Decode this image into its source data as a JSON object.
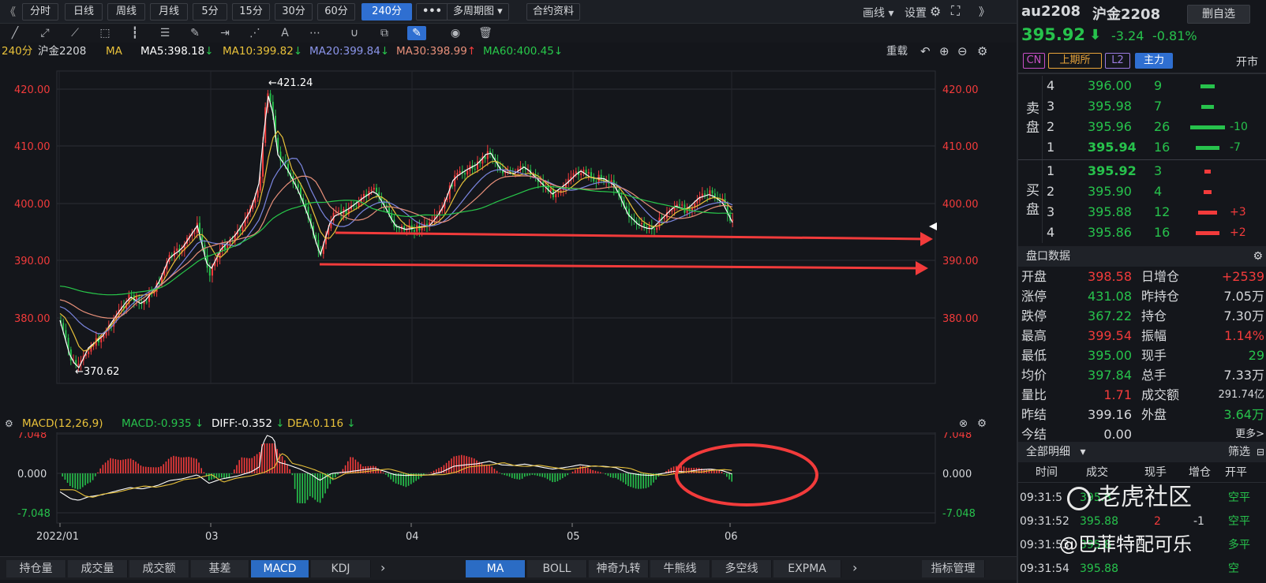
{
  "toolbar": {
    "periods": [
      "分时",
      "日线",
      "周线",
      "月线",
      "5分",
      "15分",
      "30分",
      "60分",
      "240分"
    ],
    "active_period": "240分",
    "more": "•••",
    "multi_period": "多周期图",
    "contract_info": "合约资料",
    "draw_line": "画线",
    "settings": "设置"
  },
  "legend": {
    "period": "240分",
    "name": "沪金2208",
    "indicator": "MA",
    "ma5": "MA5:398.18",
    "ma10": "MA10:399.82",
    "ma20": "MA20:399.84",
    "ma30": "MA30:398.99",
    "ma60": "MA60:400.45",
    "reload": "重载"
  },
  "macd_legend": {
    "title": "MACD(12,26,9)",
    "macd": "MACD:-0.935",
    "diff": "DIFF:-0.352",
    "dea": "DEA:0.116"
  },
  "colors": {
    "up": "#f23b3b",
    "down": "#27c24c",
    "ma5": "#ffffff",
    "ma10": "#e8c13a",
    "ma20": "#7b86e0",
    "ma30": "#e8907a",
    "ma60": "#28c84a"
  },
  "main_axis": {
    "ticks": [
      "420.00",
      "410.00",
      "400.00",
      "390.00",
      "380.00"
    ],
    "high_label": "←421.24",
    "low_label": "←370.62"
  },
  "macd_axis": {
    "ticks": [
      "7.048",
      "0.000",
      "-7.048"
    ]
  },
  "date_axis": [
    "2022/01",
    "03",
    "04",
    "05",
    "06"
  ],
  "bottom_tabs_left": [
    "持仓量",
    "成交量",
    "成交额",
    "基差",
    "MACD",
    "KDJ"
  ],
  "bottom_tabs_right": [
    "MA",
    "BOLL",
    "神奇九转",
    "牛熊线",
    "多空线",
    "EXPMA"
  ],
  "active_left_tab": "MACD",
  "active_right_tab": "MA",
  "indicator_manage": "指标管理",
  "quote": {
    "code": "au2208",
    "name": "沪金2208",
    "delete_btn": "删自选",
    "price": "395.92",
    "change": "-3.24",
    "change_pct": "-0.81%",
    "tags": [
      "CN",
      "上期所",
      "L2",
      "主力"
    ],
    "status": "开市"
  },
  "order_book": {
    "sell_label": [
      "卖",
      "盘"
    ],
    "buy_label": [
      "买",
      "盘"
    ],
    "asks": [
      {
        "lvl": "4",
        "price": "396.00",
        "vol": "9",
        "delta": ""
      },
      {
        "lvl": "3",
        "price": "395.98",
        "vol": "7",
        "delta": ""
      },
      {
        "lvl": "2",
        "price": "395.96",
        "vol": "26",
        "delta": "-10"
      },
      {
        "lvl": "1",
        "price": "395.94",
        "vol": "16",
        "delta": "-7"
      }
    ],
    "bids": [
      {
        "lvl": "1",
        "price": "395.92",
        "vol": "3",
        "delta": ""
      },
      {
        "lvl": "2",
        "price": "395.90",
        "vol": "4",
        "delta": ""
      },
      {
        "lvl": "3",
        "price": "395.88",
        "vol": "12",
        "delta": "+3"
      },
      {
        "lvl": "4",
        "price": "395.86",
        "vol": "16",
        "delta": "+2"
      }
    ]
  },
  "pankou": {
    "title": "盘口数据",
    "rows": [
      {
        "k1": "开盘",
        "v1": "398.58",
        "k2": "日增仓",
        "v2": "+2539"
      },
      {
        "k1": "涨停",
        "v1": "431.08",
        "k2": "昨持仓",
        "v2": "7.05万"
      },
      {
        "k1": "跌停",
        "v1": "367.22",
        "k2": "持仓",
        "v2": "7.30万"
      },
      {
        "k1": "最高",
        "v1": "399.54",
        "k2": "振幅",
        "v2": "1.14%"
      },
      {
        "k1": "最低",
        "v1": "395.00",
        "k2": "现手",
        "v2": "29"
      },
      {
        "k1": "均价",
        "v1": "397.84",
        "k2": "总手",
        "v2": "7.33万"
      },
      {
        "k1": "量比",
        "v1": "1.71",
        "k2": "成交额",
        "v2": "291.74亿"
      },
      {
        "k1": "昨结",
        "v1": "399.16",
        "k2": "外盘",
        "v2": "3.64万"
      },
      {
        "k1": "今结",
        "v1": "0.00",
        "k2": "",
        "v2": "更多>"
      }
    ]
  },
  "detail": {
    "title": "全部明细",
    "filter": "筛选",
    "cols": [
      "时间",
      "成交",
      "现手",
      "增仓",
      "开平"
    ],
    "rows": [
      {
        "t": "09:31:5",
        "p": "395.8",
        "q": "",
        "oi": "",
        "type": "空平"
      },
      {
        "t": "09:31:52",
        "p": "395.88",
        "q": "2",
        "oi": "-1",
        "type": "空平"
      },
      {
        "t": "09:31:53",
        "p": "395.8",
        "q": "",
        "oi": "",
        "type": "多平"
      },
      {
        "t": "09:31:54",
        "p": "395.88",
        "q": "",
        "oi": "",
        "type": "空"
      }
    ]
  },
  "watermark": {
    "brand": "老虎社区",
    "author": "@巴菲特配可乐"
  }
}
